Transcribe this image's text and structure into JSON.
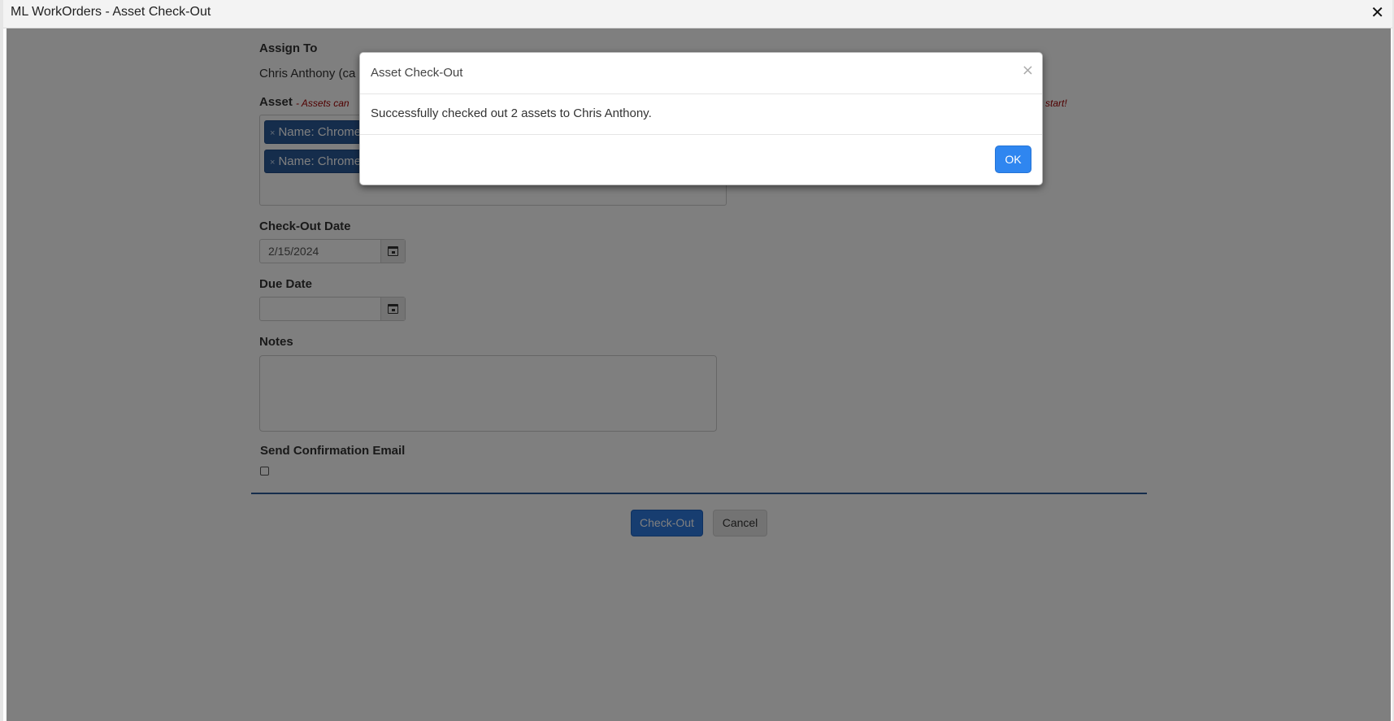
{
  "window": {
    "title": "ML WorkOrders - Asset Check-Out",
    "close_glyph": "✕"
  },
  "form": {
    "assign_to_label": "Assign To",
    "assign_to_value": "Chris Anthony (ca",
    "asset_label": "Asset",
    "asset_hint_visible_left": "- Assets can",
    "asset_hint_visible_right": "start!",
    "asset_chips": [
      {
        "remove_glyph": "×",
        "text": "Name: Chrome"
      },
      {
        "remove_glyph": "×",
        "text": "Name: Chrome"
      }
    ],
    "checkout_date_label": "Check-Out Date",
    "checkout_date_value": "2/15/2024",
    "due_date_label": "Due Date",
    "due_date_value": "",
    "notes_label": "Notes",
    "notes_value": "",
    "send_email_label": "Send Confirmation Email",
    "send_email_checked": false
  },
  "actions": {
    "checkout_label": "Check-Out",
    "cancel_label": "Cancel"
  },
  "modal": {
    "title": "Asset Check-Out",
    "close_glyph": "×",
    "message": "Successfully checked out 2 assets to Chris Anthony.",
    "ok_label": "OK"
  },
  "colors": {
    "primary": "#2f7be0",
    "chip": "#2a5a99",
    "hint": "#a10000",
    "overlay": "rgba(0,0,0,0.5)"
  },
  "icons": {
    "calendar": "calendar-icon",
    "close": "close-icon"
  }
}
